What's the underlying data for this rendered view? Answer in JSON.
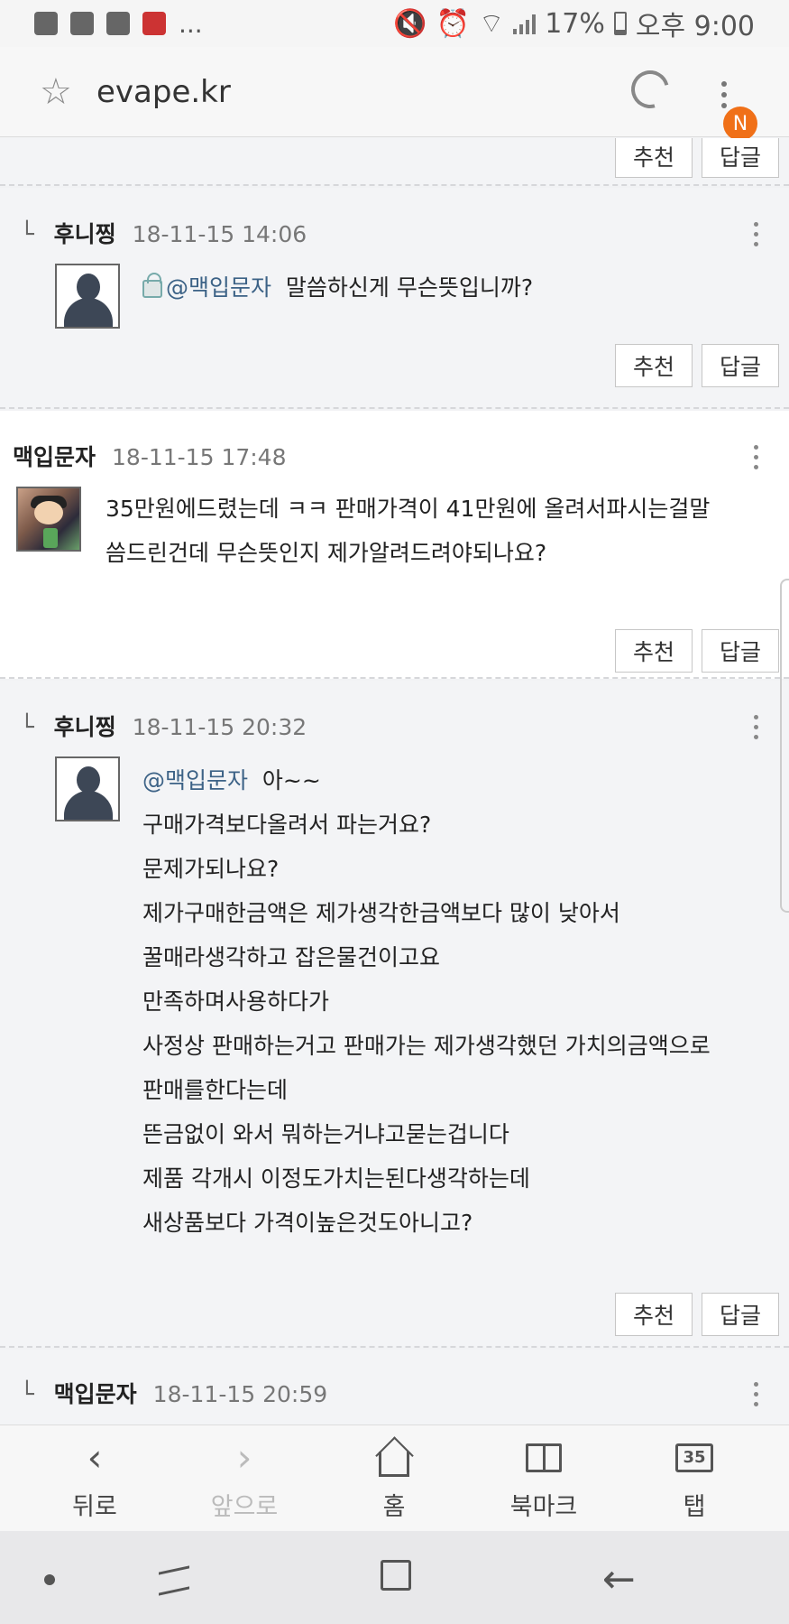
{
  "status_bar": {
    "left_icons": [
      "u-plus-icon",
      "gallery-icon",
      "news-app-icon",
      "calendar-app-icon"
    ],
    "more": "...",
    "battery": "17%",
    "time": "오후 9:00"
  },
  "address_bar": {
    "url": "evape.kr",
    "notification_badge": "N"
  },
  "comments": [
    {
      "type": "buttons_only",
      "recommend_label": "추천",
      "reply_label": "답글"
    },
    {
      "type": "reply",
      "author": "후니찡",
      "date": "18-11-15 14:06",
      "mention": "@맥입문자",
      "lines": [
        "말씀하신게 무슨뜻입니까?"
      ],
      "recommend_label": "추천",
      "reply_label": "답글"
    },
    {
      "type": "main",
      "author": "맥입문자",
      "date": "18-11-15 17:48",
      "lines": [
        "35만원에드렸는데 ㅋㅋ 판매가격이 41만원에 올려서파시는걸말",
        "씀드린건데 무슨뜻인지 제가알려드려야되나요?"
      ],
      "recommend_label": "추천",
      "reply_label": "답글"
    },
    {
      "type": "reply",
      "author": "후니찡",
      "date": "18-11-15 20:32",
      "mention": "@맥입문자",
      "first_line_rest": "아~~",
      "lines": [
        "구매가격보다올려서 파는거요?",
        "문제가되나요?",
        "제가구매한금액은 제가생각한금액보다 많이 낮아서",
        "꿀매라생각하고 잡은물건이고요",
        "만족하며사용하다가",
        "사정상 판매하는거고 판매가는 제가생각했던 가치의금액으로",
        "판매를한다는데",
        "뜬금없이 와서 뭐하는거냐고묻는겁니다",
        "제품  각개시 이정도가치는된다생각하는데",
        "새상품보다 가격이높은것도아니고?"
      ],
      "recommend_label": "추천",
      "reply_label": "답글"
    },
    {
      "type": "reply",
      "author": "맥입문자",
      "date": "18-11-15 20:59"
    }
  ],
  "bottom_nav": [
    {
      "label": "뒤로",
      "icon": "back-chevron-icon"
    },
    {
      "label": "앞으로",
      "icon": "forward-chevron-icon"
    },
    {
      "label": "홈",
      "icon": "home-icon"
    },
    {
      "label": "북마크",
      "icon": "bookmark-icon"
    },
    {
      "label": "탭",
      "icon": "tabs-icon",
      "count": "35"
    }
  ]
}
